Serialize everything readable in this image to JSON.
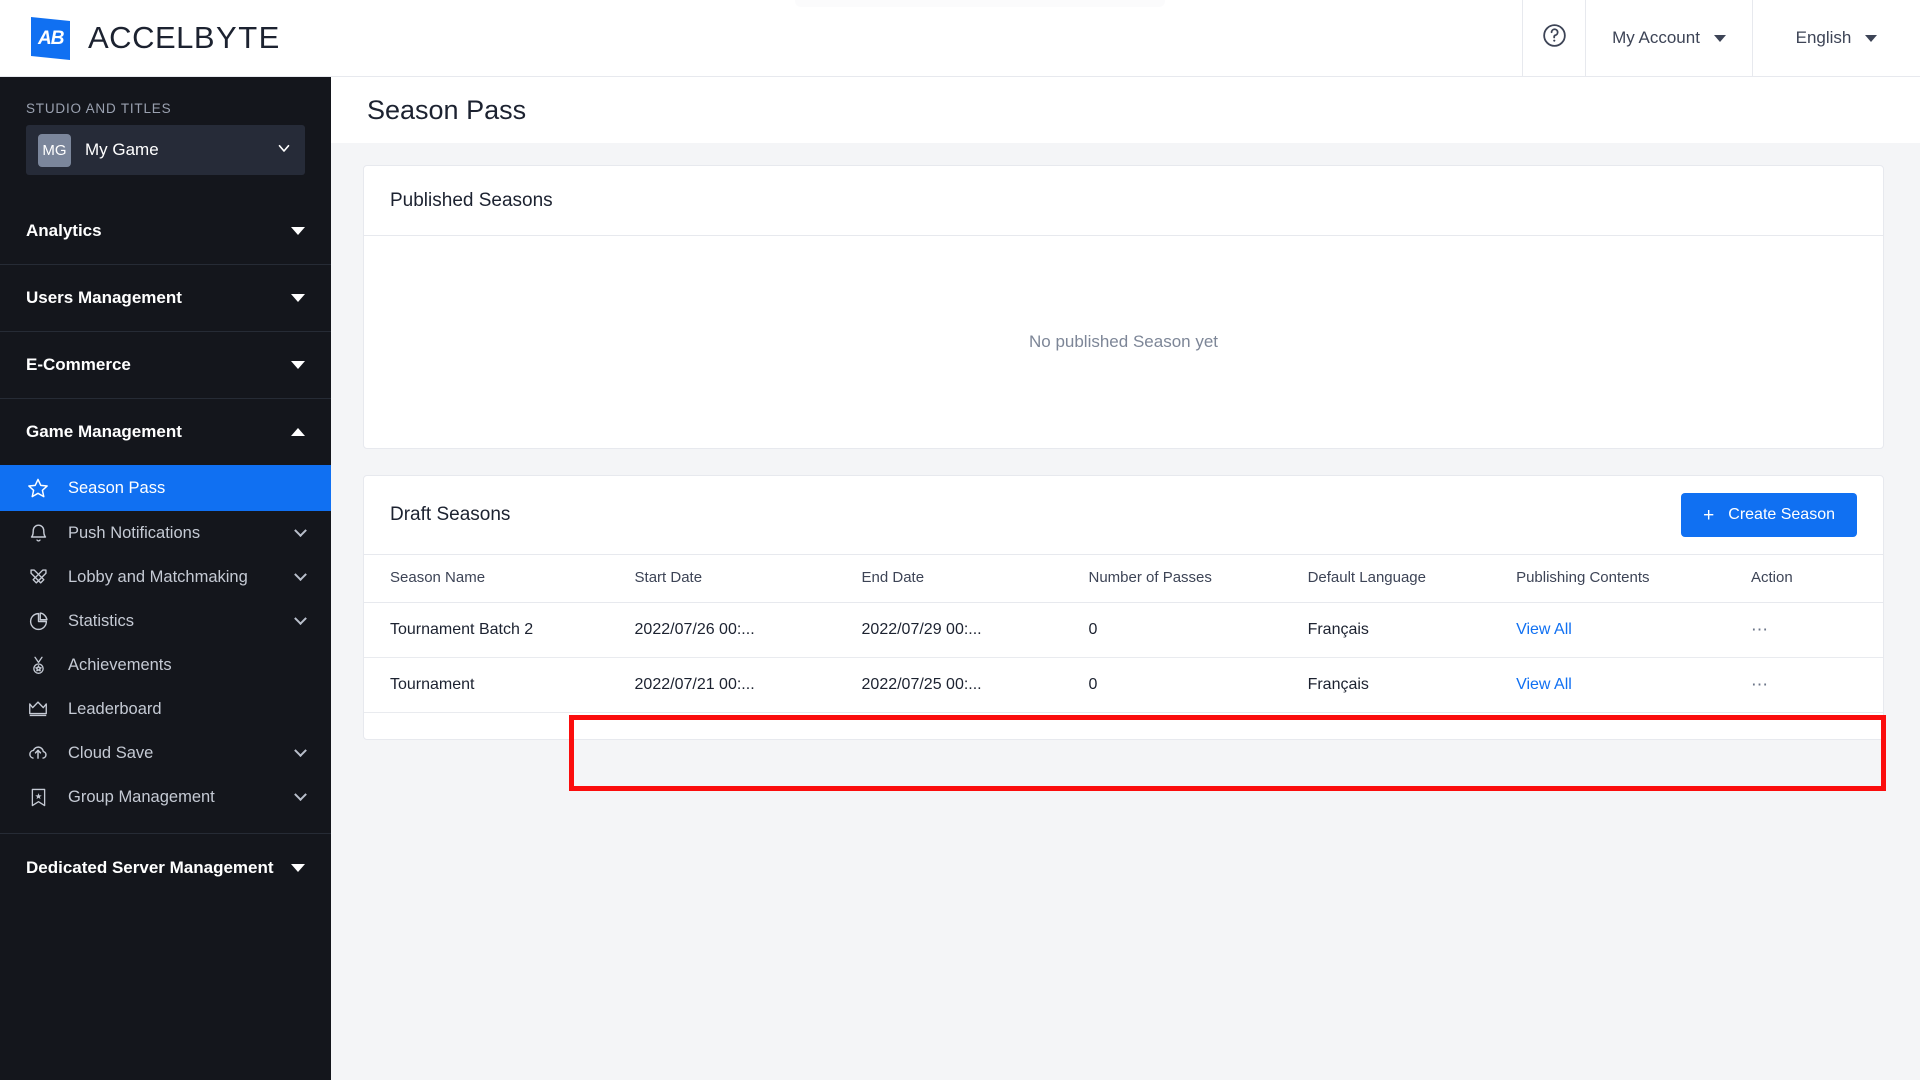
{
  "brand": {
    "mark_text": "AB",
    "name_light": "ACCEL",
    "name_bold": "BYTE"
  },
  "topbar": {
    "help_label": "?",
    "account_label": "My Account",
    "language_label": "English"
  },
  "sidebar": {
    "section_label": "STUDIO AND TITLES",
    "game": {
      "initials": "MG",
      "name": "My Game"
    },
    "groups": [
      {
        "label": "Analytics",
        "state": "collapsed"
      },
      {
        "label": "Users Management",
        "state": "collapsed"
      },
      {
        "label": "E-Commerce",
        "state": "collapsed"
      },
      {
        "label": "Game Management",
        "state": "expanded"
      },
      {
        "label": "Dedicated Server Management",
        "state": "collapsed"
      }
    ],
    "items": [
      {
        "label": "Season Pass",
        "icon": "star-icon",
        "active": true,
        "expandable": false
      },
      {
        "label": "Push Notifications",
        "icon": "bell-icon",
        "active": false,
        "expandable": true
      },
      {
        "label": "Lobby and Matchmaking",
        "icon": "crossed-swords-icon",
        "active": false,
        "expandable": true
      },
      {
        "label": "Statistics",
        "icon": "pie-chart-icon",
        "active": false,
        "expandable": true
      },
      {
        "label": "Achievements",
        "icon": "medal-icon",
        "active": false,
        "expandable": false
      },
      {
        "label": "Leaderboard",
        "icon": "crown-icon",
        "active": false,
        "expandable": false
      },
      {
        "label": "Cloud Save",
        "icon": "cloud-upload-icon",
        "active": false,
        "expandable": true
      },
      {
        "label": "Group Management",
        "icon": "banner-icon",
        "active": false,
        "expandable": true
      }
    ]
  },
  "page": {
    "title": "Season Pass"
  },
  "published": {
    "title": "Published Seasons",
    "empty_text": "No published Season yet"
  },
  "draft": {
    "title": "Draft Seasons",
    "create_label": "Create Season",
    "create_icon": "plus-icon",
    "columns": [
      "Season Name",
      "Start Date",
      "End Date",
      "Number of Passes",
      "Default Language",
      "Publishing Contents",
      "Action"
    ],
    "rows": [
      {
        "name": "Tournament Batch 2",
        "start": "2022/07/26 00:...",
        "end": "2022/07/29 00:...",
        "passes": "0",
        "language": "Français",
        "publishing": "View All",
        "action": "⋯",
        "highlighted": true
      },
      {
        "name": "Tournament",
        "start": "2022/07/21 00:...",
        "end": "2022/07/25 00:...",
        "passes": "0",
        "language": "Français",
        "publishing": "View All",
        "action": "⋯",
        "highlighted": false
      }
    ]
  },
  "colors": {
    "accent_blue": "#1070f2",
    "sidebar_bg": "#14161c",
    "highlight_red": "#fb0d0d",
    "page_bg": "#f4f5f7"
  }
}
